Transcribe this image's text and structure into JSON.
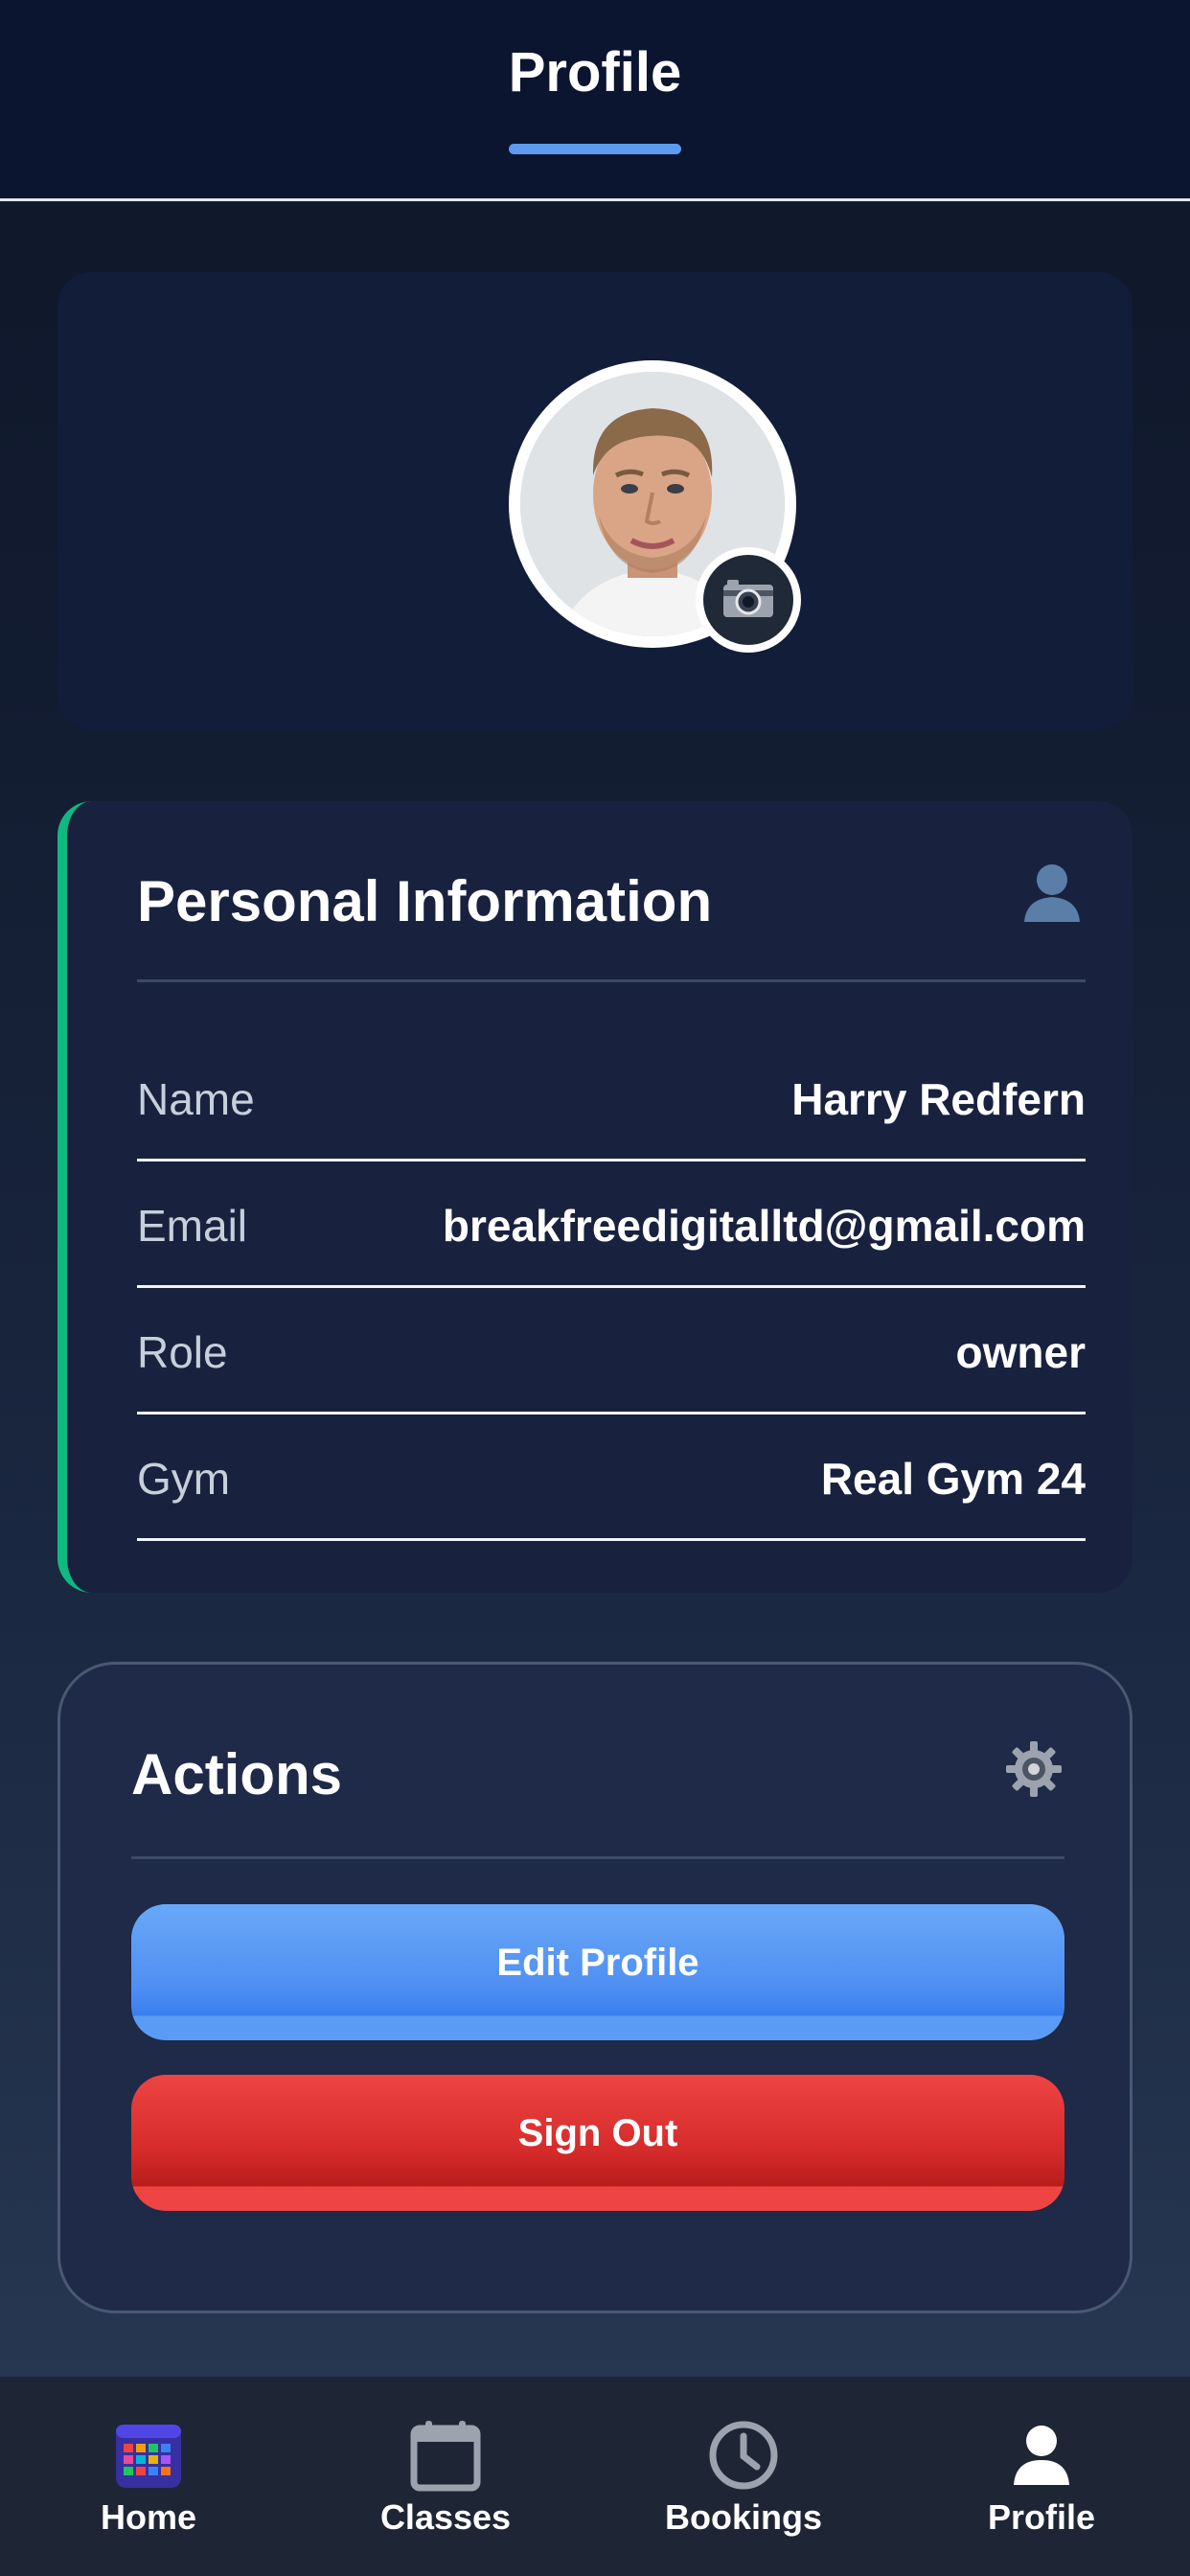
{
  "header": {
    "title": "Profile"
  },
  "avatar": {
    "photo_icon": "user-photo",
    "camera_icon": "camera-icon"
  },
  "personal_info": {
    "title": "Personal Information",
    "icon": "person-icon",
    "accent_color": "#10b981",
    "rows": [
      {
        "label": "Name",
        "value": "Harry Redfern"
      },
      {
        "label": "Email",
        "value": "breakfreedigitalltd@gmail.com"
      },
      {
        "label": "Role",
        "value": "owner"
      },
      {
        "label": "Gym",
        "value": "Real Gym 24"
      }
    ]
  },
  "actions": {
    "title": "Actions",
    "icon": "gear-icon",
    "edit_label": "Edit Profile",
    "signout_label": "Sign Out",
    "edit_color": "#4f8ff2",
    "signout_color": "#dc2626"
  },
  "nav": {
    "items": [
      {
        "label": "Home",
        "icon": "calendar-grid-icon"
      },
      {
        "label": "Classes",
        "icon": "calendar-icon"
      },
      {
        "label": "Bookings",
        "icon": "clock-icon"
      },
      {
        "label": "Profile",
        "icon": "person-icon",
        "active": true
      }
    ]
  }
}
